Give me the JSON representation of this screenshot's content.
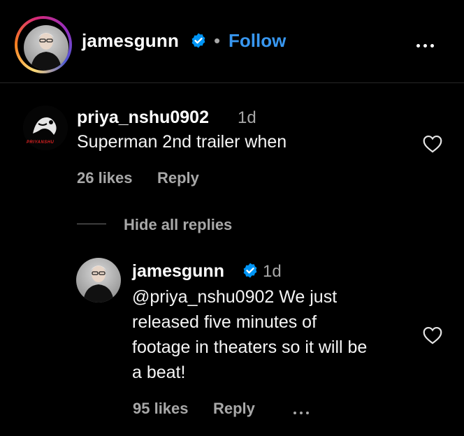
{
  "post_header": {
    "username": "jamesgunn",
    "separator": "•",
    "follow_label": "Follow"
  },
  "comment": {
    "username": "priya_nshu0902",
    "time": "1d",
    "text": "Superman 2nd trailer when",
    "likes": "26 likes",
    "reply_label": "Reply",
    "avatar_caption": "PRIYANSHU"
  },
  "replies_toggle": {
    "label": "Hide all replies"
  },
  "reply": {
    "username": "jamesgunn",
    "time": "1d",
    "text_lines": [
      "@priya_nshu0902 We just",
      "released five minutes of",
      "footage in theaters so it will be",
      "a beat!"
    ],
    "likes": "95 likes",
    "reply_label": "Reply"
  },
  "colors": {
    "background": "#000000",
    "link_blue": "#3897f0",
    "verified_blue": "#0095f6",
    "muted_text": "#a8a8a8"
  },
  "icons": [
    "verified-badge-icon",
    "more-options-icon",
    "heart-icon"
  ]
}
